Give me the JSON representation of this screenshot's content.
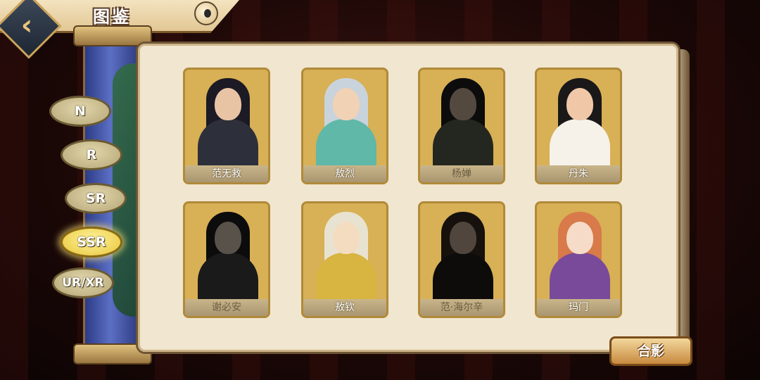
{
  "header": {
    "title": "图鉴",
    "back_icon": "‹"
  },
  "rarity_tabs": [
    {
      "label": "N",
      "active": false
    },
    {
      "label": "R",
      "active": false
    },
    {
      "label": "SR",
      "active": false
    },
    {
      "label": "SSR",
      "active": true
    },
    {
      "label": "UR/XR",
      "active": false
    }
  ],
  "cards": [
    {
      "name": "范无救",
      "locked": false,
      "hair": "#1c1a24",
      "skin": "#e9c4a4",
      "robe": "#2d2f3a"
    },
    {
      "name": "敖烈",
      "locked": false,
      "hair": "#c9d3dc",
      "skin": "#f1d2b5",
      "robe": "#5fb8a8"
    },
    {
      "name": "杨婵",
      "locked": true,
      "hair": "#1d1b1f",
      "skin": "#caa07a",
      "robe": "#4a5a3a"
    },
    {
      "name": "丹朱",
      "locked": false,
      "hair": "#1a1818",
      "skin": "#f0c8a8",
      "robe": "#f6f2ea"
    },
    {
      "name": "谢必安",
      "locked": true,
      "hair": "#1a1a1a",
      "skin": "#cfb59a",
      "robe": "#3a3a3a"
    },
    {
      "name": "敖钦",
      "locked": false,
      "hair": "#e8e3d0",
      "skin": "#f4dcc0",
      "robe": "#d8b440"
    },
    {
      "name": "范·海尔辛",
      "locked": true,
      "hair": "#3a2418",
      "skin": "#c29a76",
      "robe": "#1f1a18"
    },
    {
      "name": "玛门",
      "locked": false,
      "hair": "#d87a4a",
      "skin": "#f6dcc8",
      "robe": "#7a4a9a"
    }
  ],
  "photo_button": {
    "label": "合影"
  },
  "colors": {
    "accent": "#e8c53a",
    "panel": "#f1e6cf",
    "card_frame": "#b08a3a"
  }
}
